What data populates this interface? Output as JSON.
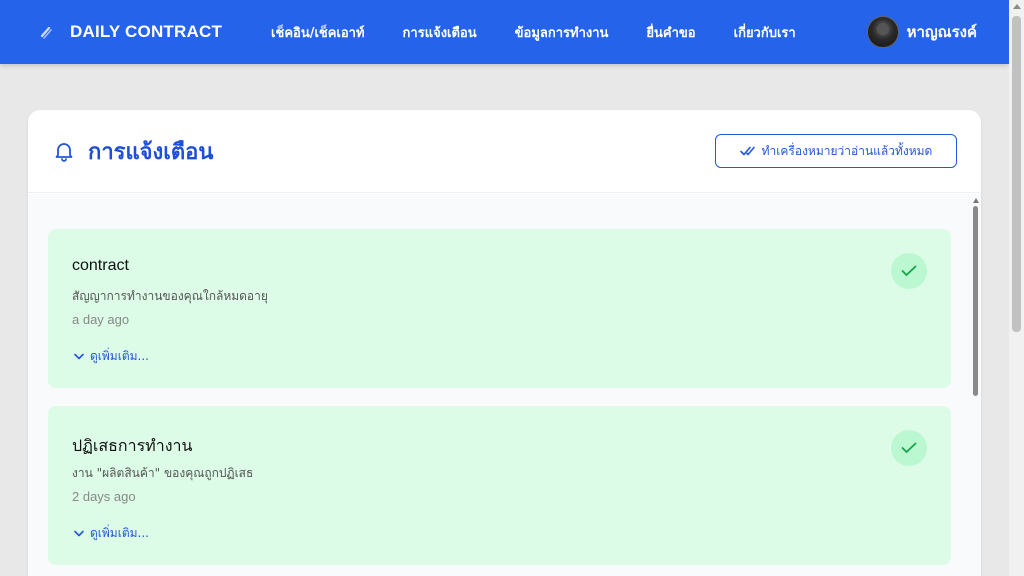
{
  "navbar": {
    "brand": "DAILY CONTRACT",
    "links": [
      "เช็คอิน/เช็คเอาท์",
      "การแจ้งเตือน",
      "ข้อมูลการทำงาน",
      "ยื่นคำขอ",
      "เกี่ยวกับเรา"
    ],
    "user_name": "หาญณรงค์"
  },
  "page": {
    "title": "การแจ้งเตือน",
    "mark_all_label": "ทำเครื่องหมายว่าอ่านแล้วทั้งหมด"
  },
  "notifications": [
    {
      "title": "contract",
      "message": "สัญญาการทำงานของคุณใกล้หมดอายุ",
      "time": "a day ago",
      "more_label": "ดูเพิ่มเติม..."
    },
    {
      "title": "ปฏิเสธการทำงาน",
      "message": "งาน \"ผลิตสินค้า\" ของคุณถูกปฏิเสธ",
      "time": "2 days ago",
      "more_label": "ดูเพิ่มเติม..."
    }
  ],
  "colors": {
    "nav_bg": "#2563eb",
    "accent": "#2356d8",
    "read_bg": "#dcfce7",
    "check_bg": "#bbf7d0",
    "check_icon": "#16a34a"
  },
  "icons": [
    "logo-icon",
    "bell-icon",
    "double-check-icon",
    "chevron-down-icon",
    "check-icon"
  ]
}
